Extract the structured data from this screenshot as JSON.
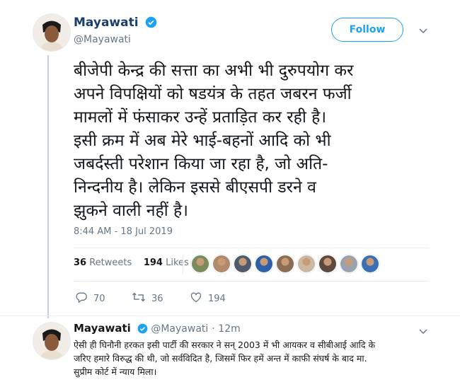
{
  "tweet": {
    "author_name": "Mayawati",
    "author_handle": "@Mayawati",
    "follow_label": "Follow",
    "text": "बीजेपी केन्द्र की सत्ता का अभी भी दुरुपयोग कर\nअपने विपक्षियों को षडयंत्र के तहत जबरन फर्जी\nमामलों में फंसाकर उन्हें प्रताड़ित कर रही है।\nइसी क्रम में अब मेरे भाई-बहनों आदि को भी\nजबर्दस्ती परेशान किया जा रहा है, जो अति-\nनिन्दनीय है। लेकिन इससे बीएसपी डरने व\nझुकने वाली नहीं है।",
    "timestamp": "8:44 AM - 18 Jul 2019",
    "retweets_count": "36",
    "retweets_label": "Retweets",
    "likes_count": "194",
    "likes_label": "Likes",
    "likers_colors": [
      "#7a8c5a",
      "#b08a6a",
      "#4f5a6b",
      "#2f5fa8",
      "#8a6d52",
      "#c9b9a1",
      "#5d4a3e",
      "#9aa3ad",
      "#3b6fb5"
    ],
    "reply_count": "70",
    "retweet_count": "36",
    "like_count": "194"
  },
  "reply": {
    "author_name": "Mayawati",
    "author_handle": "@Mayawati",
    "separator": "·",
    "time_ago": "12m",
    "text": "ऐसी ही घिनौनी हरकत इसी पार्टी की सरकार ने सन् 2003 में भी आयकर व सीबीआई आदि के\nजरिए हमारे विरुद्ध की थी, जो सर्वविदित है, जिसमें फिर हमें अन्त में काफी संघर्ष के बाद मा.\nसुप्रीम कोर्ट में न्याय मिला।"
  },
  "icons": {
    "verified": "verified-badge-icon",
    "caret": "chevron-down-icon",
    "reply": "reply-icon",
    "retweet": "retweet-icon",
    "like": "heart-icon"
  },
  "colors": {
    "accent": "#1da1f2",
    "text": "#14171a",
    "muted": "#657786"
  }
}
